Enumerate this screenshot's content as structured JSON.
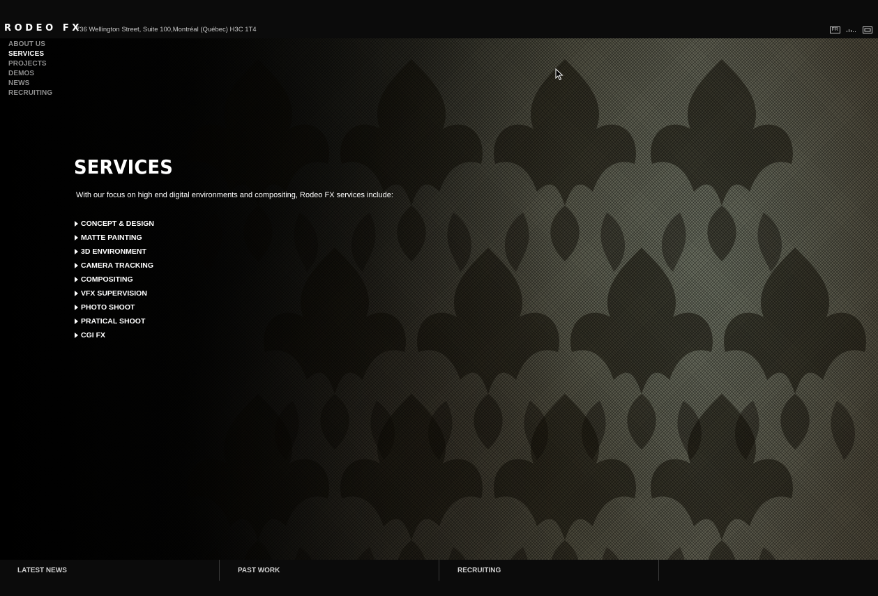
{
  "header": {
    "logo": "RODEO FX",
    "address": "736 Wellington Street, Suite 100,Montréal (Québec) H3C 1T4",
    "lang_button": "FR",
    "icons": [
      "language-icon",
      "sound-icon",
      "fullscreen-icon"
    ]
  },
  "nav": {
    "items": [
      {
        "label": "ABOUT US",
        "active": false
      },
      {
        "label": "SERVICES",
        "active": true
      },
      {
        "label": "PROJECTS",
        "active": false
      },
      {
        "label": "DEMOS",
        "active": false
      },
      {
        "label": "NEWS",
        "active": false
      },
      {
        "label": "RECRUITING",
        "active": false
      }
    ]
  },
  "main": {
    "title": "SERVICES",
    "intro": "With our focus on high end digital environments and compositing, Rodeo FX services include:",
    "services": [
      "CONCEPT & DESIGN",
      "MATTE PAINTING",
      "3D ENVIRONMENT",
      "CAMERA TRACKING",
      "COMPOSITING",
      "VFX SUPERVISION",
      "PHOTO SHOOT",
      "PRATICAL SHOOT",
      "CGI FX"
    ]
  },
  "footer": {
    "items": [
      "LATEST NEWS",
      "PAST WORK",
      "RECRUITING",
      ""
    ]
  },
  "colors": {
    "background": "#0b0b0b",
    "text": "#ffffff",
    "nav_inactive": "#8e8e8e"
  }
}
